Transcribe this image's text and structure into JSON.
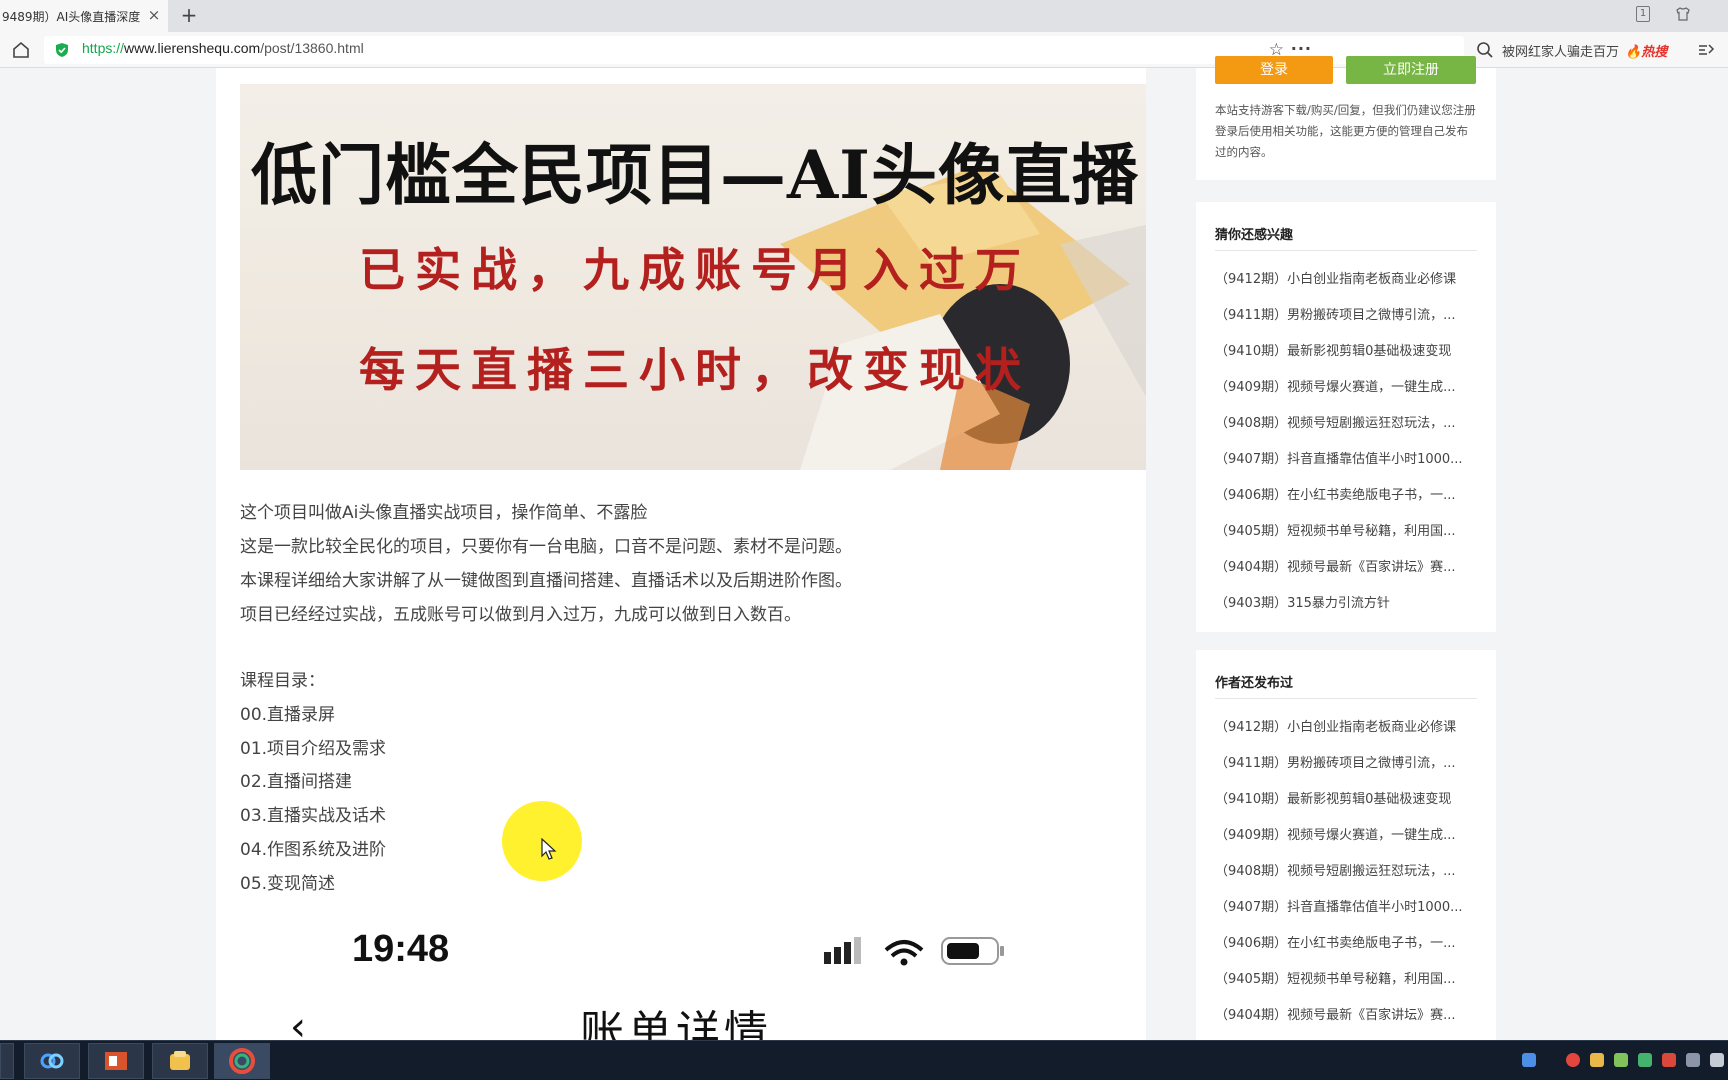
{
  "browser": {
    "tab_title": "9489期）AI头像直播深度",
    "tab_close": "×",
    "new_tab": "+",
    "window_badge": "1",
    "url_scheme": "https://",
    "url_host": "www.lierenshequ.com",
    "url_path": "/post/13860.html",
    "star": "☆",
    "more": "···",
    "hot_search": "被网红家人骗走百万",
    "hot_tag": "热搜"
  },
  "banner": {
    "title": "低门槛全民项目—AI头像直播",
    "line1": "已实战，九成账号月入过万",
    "line2": "每天直播三小时，改变现状"
  },
  "article": {
    "paragraphs": [
      "这个项目叫做Ai头像直播实战项目，操作简单、不露脸",
      "这是一款比较全民化的项目，只要你有一台电脑，口音不是问题、素材不是问题。",
      "本课程详细给大家讲解了从一键做图到直播间搭建、直播话术以及后期进阶作图。",
      "项目已经经过实战，五成账号可以做到月入过万，九成可以做到日入数百。"
    ],
    "toc_title": "课程目录：",
    "toc": [
      "00.直播录屏",
      "01.项目介绍及需求",
      "02.直播间搭建",
      "03.直播实战及话术",
      "04.作图系统及进阶",
      "05.变现简述"
    ]
  },
  "phone": {
    "time": "19:48",
    "back": "‹",
    "heading": "账单详情"
  },
  "sidebar": {
    "login_label": "登录",
    "register_label": "立即注册",
    "notice": "本站支持游客下载/购买/回复，但我们仍建议您注册登录后使用相关功能，这能更方便的管理自己发布过的内容。",
    "guess_title": "猜你还感兴趣",
    "guess_items": [
      "（9412期）小白创业指南老板商业必修课",
      "（9411期）男粉搬砖项目之微博引流，...",
      "（9410期）最新影视剪辑0基础极速变现",
      "（9409期）视频号爆火赛道，一键生成...",
      "（9408期）视频号短剧搬运狂怼玩法，...",
      "（9407期）抖音直播靠估值半小时1000...",
      "（9406期）在小红书卖绝版电子书，一...",
      "（9405期）短视频书单号秘籍，利用国...",
      "（9404期）视频号最新《百家讲坛》赛...",
      "（9403期）315暴力引流方针"
    ],
    "author_title": "作者还发布过",
    "author_items": [
      "（9412期）小白创业指南老板商业必修课",
      "（9411期）男粉搬砖项目之微博引流，...",
      "（9410期）最新影视剪辑0基础极速变现",
      "（9409期）视频号爆火赛道，一键生成...",
      "（9408期）视频号短剧搬运狂怼玩法，...",
      "（9407期）抖音直播靠估值半小时1000...",
      "（9406期）在小红书卖绝版电子书，一...",
      "（9405期）短视频书单号秘籍，利用国...",
      "（9404期）视频号最新《百家讲坛》赛..."
    ]
  },
  "colors": {
    "https_green": "#11a84d",
    "login_orange": "#f39a12",
    "register_green": "#77b544",
    "banner_red": "#b3201e",
    "hot_red": "#e5322d"
  }
}
